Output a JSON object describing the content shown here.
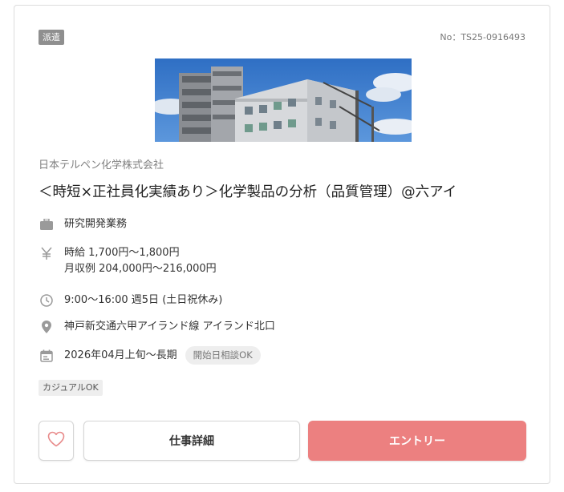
{
  "job": {
    "type_badge": "派遣",
    "number": "No：TS25-0916493",
    "company": "日本テルペン化学株式会社",
    "title": "＜時短×正社員化実績あり＞化学製品の分析（品質管理）@六アイ",
    "category": "研究開発業務",
    "wage_hourly": "時給 1,700円〜1,800円",
    "wage_monthly": "月収例 204,000円〜216,000円",
    "hours": "9:00〜16:00 週5日 (土日祝休み)",
    "location": "神戸新交通六甲アイランド線 アイランド北口",
    "period": "2026年04月上旬〜長期",
    "start_tag": "開始日相談OK",
    "casual_tag": "カジュアルOK"
  },
  "buttons": {
    "favorite_icon": "heart-outline-icon",
    "detail_label": "仕事詳細",
    "entry_label": "エントリー"
  },
  "icons": {
    "category": "briefcase-icon",
    "wage": "yen-icon",
    "hours": "clock-icon",
    "location": "map-pin-icon",
    "period": "calendar-icon"
  },
  "colors": {
    "entry_button": "#ec8080",
    "heart": "#e88a8a",
    "type_badge": "#8f8f8f"
  }
}
